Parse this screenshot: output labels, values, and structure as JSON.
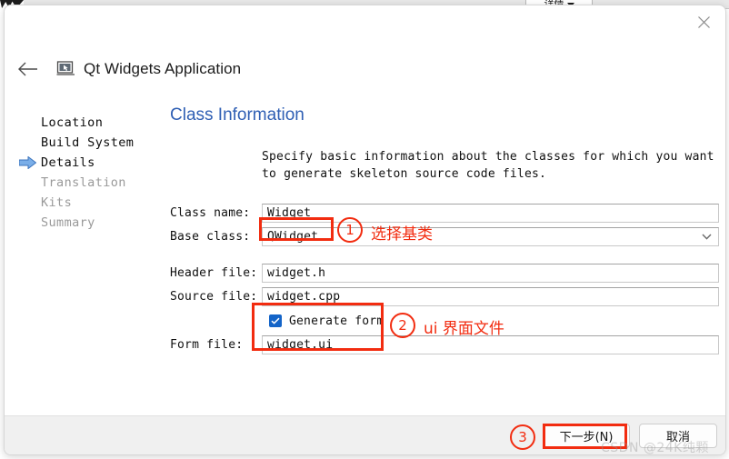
{
  "background": {
    "combo_label": "详情",
    "combo_caret_icon": "caret-down-icon"
  },
  "dialog": {
    "title": "Qt Widgets Application",
    "app_icon": "qt-widgets-app-icon",
    "back_icon": "back-arrow-icon",
    "close_icon": "close-icon"
  },
  "sidebar": {
    "items": [
      {
        "label": "Location",
        "active": false,
        "dim": false
      },
      {
        "label": "Build System",
        "active": false,
        "dim": false
      },
      {
        "label": "Details",
        "active": true,
        "dim": false
      },
      {
        "label": "Translation",
        "active": false,
        "dim": true
      },
      {
        "label": "Kits",
        "active": false,
        "dim": true
      },
      {
        "label": "Summary",
        "active": false,
        "dim": true
      }
    ],
    "active_indicator_icon": "right-arrow-icon"
  },
  "content": {
    "heading": "Class Information",
    "description": "Specify basic information about the classes for which you want to generate skeleton source code files."
  },
  "form": {
    "class_name": {
      "label": "Class name:",
      "value": "Widget"
    },
    "base_class": {
      "label": "Base class:",
      "value": "QWidget",
      "caret_icon": "chevron-down-icon"
    },
    "header_file": {
      "label": "Header file:",
      "value": "widget.h"
    },
    "source_file": {
      "label": "Source file:",
      "value": "widget.cpp"
    },
    "generate_form": {
      "label": "Generate form",
      "checked": true,
      "check_icon": "checkmark-icon"
    },
    "form_file": {
      "label": "Form file:",
      "value": "widget.ui"
    }
  },
  "footer": {
    "next_label": "下一步(N)",
    "cancel_label": "取消"
  },
  "annotations": {
    "one": {
      "number": "1",
      "text": "选择基类"
    },
    "two": {
      "number": "2",
      "text": "ui 界面文件"
    },
    "three": {
      "number": "3",
      "text": ""
    },
    "accent_color": "#f22c10"
  },
  "watermark": {
    "text": "CSDN @24K纯颗"
  }
}
